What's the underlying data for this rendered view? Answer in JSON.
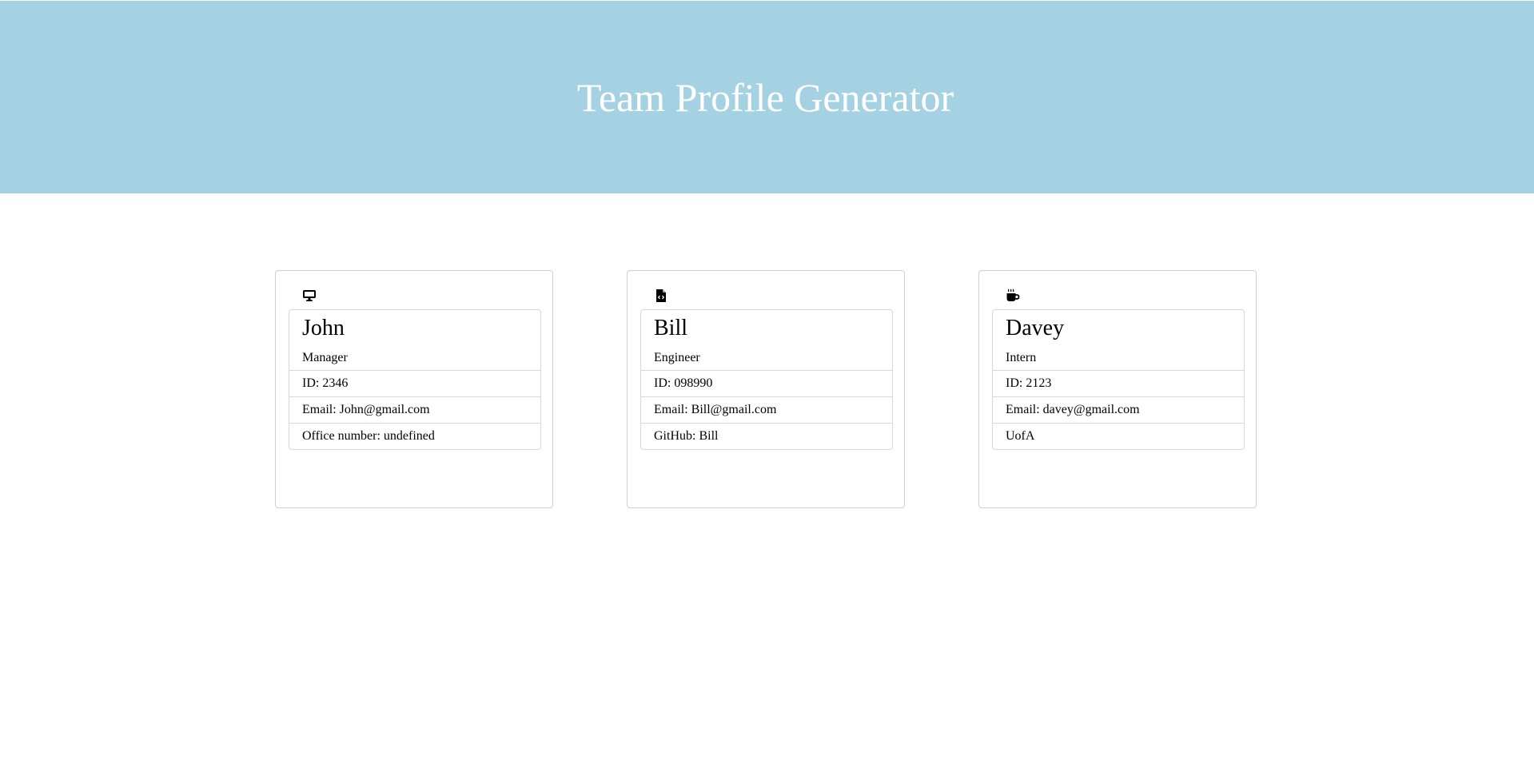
{
  "header": {
    "title": "Team Profile Generator",
    "background_color": "#a5d2e3"
  },
  "cards": [
    {
      "icon": "desktop-icon",
      "name": "John",
      "role": "Manager",
      "id_text": "ID: 2346",
      "email_text": "Email: John@gmail.com",
      "extra_text": "Office number: undefined"
    },
    {
      "icon": "file-code-icon",
      "name": "Bill",
      "role": "Engineer",
      "id_text": "ID: 098990",
      "email_text": "Email: Bill@gmail.com",
      "extra_text": "GitHub: Bill"
    },
    {
      "icon": "coffee-mug-icon",
      "name": "Davey",
      "role": "Intern",
      "id_text": "ID: 2123",
      "email_text": "Email: davey@gmail.com",
      "extra_text": "UofA"
    }
  ]
}
